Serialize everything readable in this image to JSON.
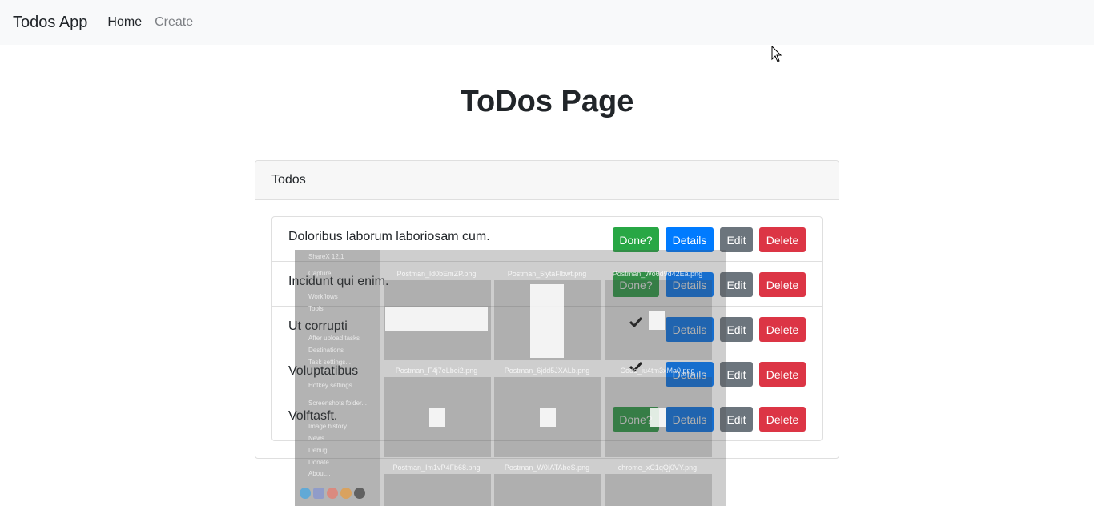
{
  "navbar": {
    "brand": "Todos App",
    "links": [
      "Home",
      "Create"
    ]
  },
  "page": {
    "title": "ToDos Page"
  },
  "card": {
    "header": "Todos"
  },
  "todos": [
    {
      "text": "Doloribus laborum laboriosam cum.",
      "done": false
    },
    {
      "text": "Incidunt qui enim.",
      "done": false
    },
    {
      "text": "Ut corrupti",
      "done": true
    },
    {
      "text": "Voluptatibus",
      "done": true
    },
    {
      "text": "Volftasft.",
      "done": false
    }
  ],
  "buttons": {
    "done": "Done?",
    "details": "Details",
    "edit": "Edit",
    "delete": "Delete"
  },
  "overlay": {
    "title": "ShareX 12.1",
    "menu": [
      "Capture",
      "Workflows",
      "Tools",
      "After upload tasks",
      "Destinations",
      "Task settings...",
      "Hotkey settings...",
      "Screenshots folder...",
      "Image history...",
      "News",
      "Debug",
      "Donate...",
      "About..."
    ],
    "files": [
      "Postman_ld0bEmZP.png",
      "Postman_5lytaFlbwt.png",
      "Postman_Wo6d9d42Ea.png",
      "Postman_F4j7eLbei2.png",
      "Postman_6jdd5JXALb.png",
      "Code_iu4tm3xMa0.png",
      "Postman_Im1vP4Fb68.png",
      "Postman_W0IATAbeS.png",
      "chrome_xC1qQj0VY.png"
    ]
  },
  "colors": {
    "success": "#28a745",
    "primary": "#007bff",
    "secondary": "#6c757d",
    "danger": "#dc3545"
  }
}
